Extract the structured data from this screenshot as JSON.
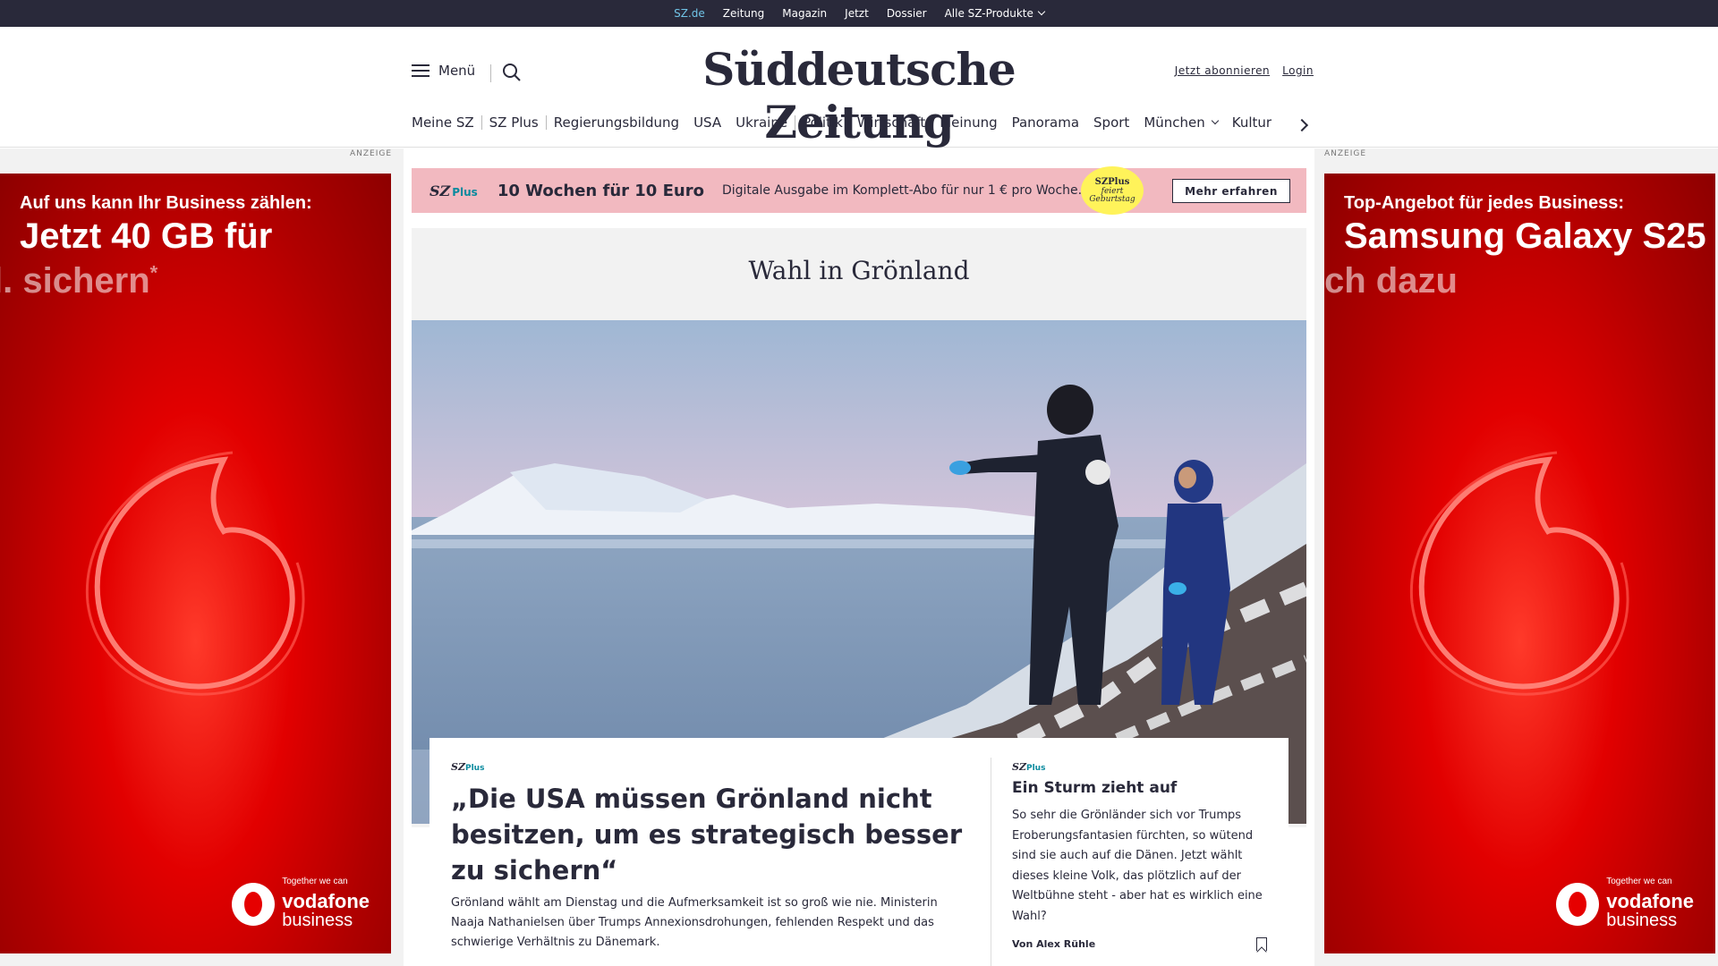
{
  "topbar": {
    "items": [
      {
        "label": "SZ.de",
        "active": true
      },
      {
        "label": "Zeitung"
      },
      {
        "label": "Magazin"
      },
      {
        "label": "Jetzt"
      },
      {
        "label": "Dossier"
      },
      {
        "label": "Alle SZ-Produkte",
        "dropdown": true
      }
    ]
  },
  "header": {
    "menu_label": "Menü",
    "logo": "Süddeutsche Zeitung",
    "subscribe_label": "Jetzt abonnieren",
    "login_label": "Login"
  },
  "nav": {
    "items": [
      "Meine SZ",
      "SZ Plus",
      "Regierungsbildung",
      "USA",
      "Ukraine",
      "Politik",
      "Wirtschaft",
      "Meinung",
      "Panorama",
      "Sport",
      "München",
      "Kultur"
    ]
  },
  "ads": {
    "label": "ANZEIGE",
    "left": {
      "tagline": "Auf uns kann Ihr Business zählen:",
      "headline": "Jetzt 40 GB für",
      "faded": "l. sichern",
      "star": "*"
    },
    "right": {
      "tagline": "Top-Angebot für jedes Business:",
      "headline": "Samsung Galaxy S25",
      "faded": "ch dazu"
    },
    "brand": {
      "claim": "Together we can",
      "name": "vodafone",
      "sub": "business"
    },
    "colors": {
      "red": "#e60000",
      "dark_red": "#8d0000"
    }
  },
  "promo": {
    "brand": "SZ",
    "brand_plus": "Plus",
    "title": "10 Wochen für 10 Euro",
    "text": "Digitale Ausgabe im Komplett-Abo für nur 1 € pro Woche.",
    "badge_brand": "SZPlus",
    "badge_line1": "feiert",
    "badge_line2": "Geburtstag",
    "cta": "Mehr erfahren",
    "colors": {
      "background": "#f2b9c0",
      "badge": "#fff35a",
      "plus": "#0a8a9e"
    }
  },
  "section": {
    "title": "Wahl in Grönland"
  },
  "articles": {
    "main": {
      "brand": "SZ",
      "brand_plus": "Plus",
      "headline": "„Die USA müssen Grönland nicht besitzen, um es strategisch besser zu sichern“",
      "teaser": "Grönland wählt am Dienstag und die Aufmerksamkeit ist so groß wie nie. Ministerin Naaja Nathanielsen über Trumps Annexionsdrohungen, fehlenden Respekt und das schwierige Verhältnis zu Dänemark."
    },
    "side": {
      "brand": "SZ",
      "brand_plus": "Plus",
      "headline": "Ein Sturm zieht auf",
      "teaser": "So sehr die Grönländer sich vor Trumps Eroberungsfantasien fürchten, so wütend sind sie auch auf die Dänen. Jetzt wählt dieses kleine Volk, das plötzlich auf der Weltbühne steht - aber hat es wirklich eine Wahl?",
      "author": "Von Alex Rühle"
    }
  },
  "icons": [
    "hamburger-icon",
    "search-icon",
    "chevron-down-icon",
    "chevron-right-icon",
    "bookmark-icon",
    "vodafone-logo-icon"
  ]
}
